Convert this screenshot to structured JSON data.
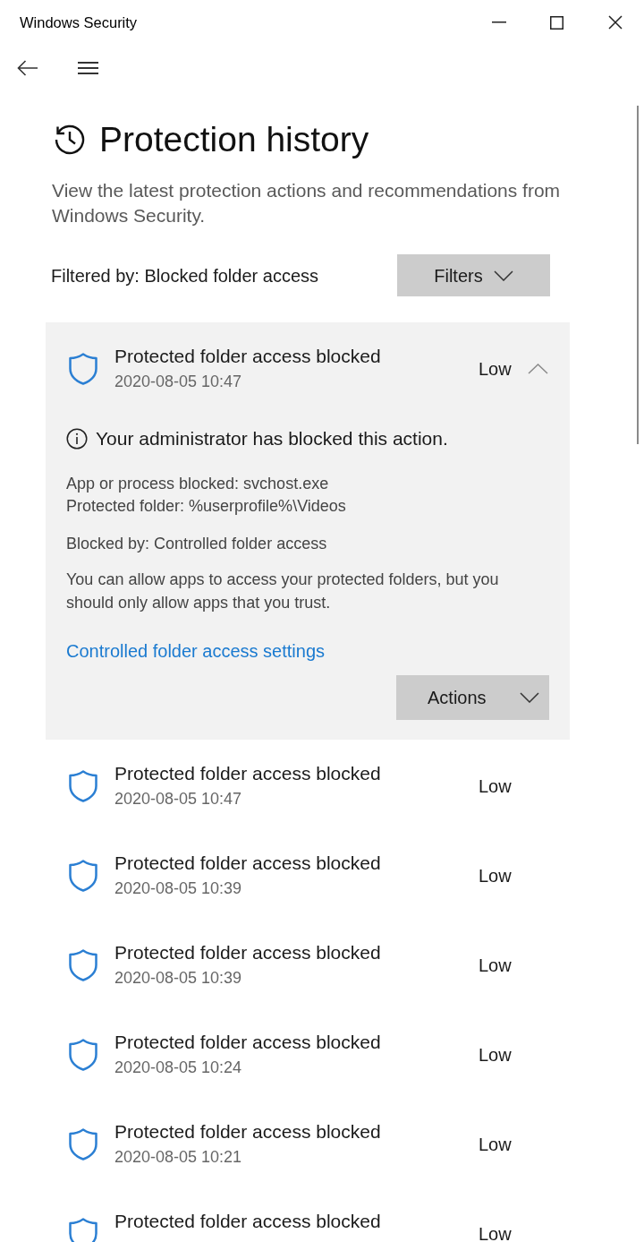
{
  "window": {
    "title": "Windows Security"
  },
  "page": {
    "title": "Protection history",
    "description": "View the latest protection actions and recommendations from Windows Security."
  },
  "filter": {
    "label": "Filtered by: Blocked folder access",
    "button": "Filters"
  },
  "events": [
    {
      "title": "Protected folder access blocked",
      "time": "2020-08-05 10:47",
      "severity": "Low",
      "expanded": true,
      "details": {
        "notice": "Your administrator has blocked this action.",
        "fields": [
          "App or process blocked: svchost.exe",
          "Protected folder: %userprofile%\\Videos"
        ],
        "blocked_by": "Blocked by: Controlled folder access",
        "message": "You can allow apps to access your protected folders, but you should only allow apps that you trust.",
        "link": "Controlled folder access settings",
        "button": "Actions"
      }
    },
    {
      "title": "Protected folder access blocked",
      "time": "2020-08-05 10:47",
      "severity": "Low",
      "expanded": false
    },
    {
      "title": "Protected folder access blocked",
      "time": "2020-08-05 10:39",
      "severity": "Low",
      "expanded": false
    },
    {
      "title": "Protected folder access blocked",
      "time": "2020-08-05 10:39",
      "severity": "Low",
      "expanded": false
    },
    {
      "title": "Protected folder access blocked",
      "time": "2020-08-05 10:24",
      "severity": "Low",
      "expanded": false
    },
    {
      "title": "Protected folder access blocked",
      "time": "2020-08-05 10:21",
      "severity": "Low",
      "expanded": false
    },
    {
      "title": "Protected folder access blocked",
      "severity": "Low",
      "expanded": false
    }
  ]
}
